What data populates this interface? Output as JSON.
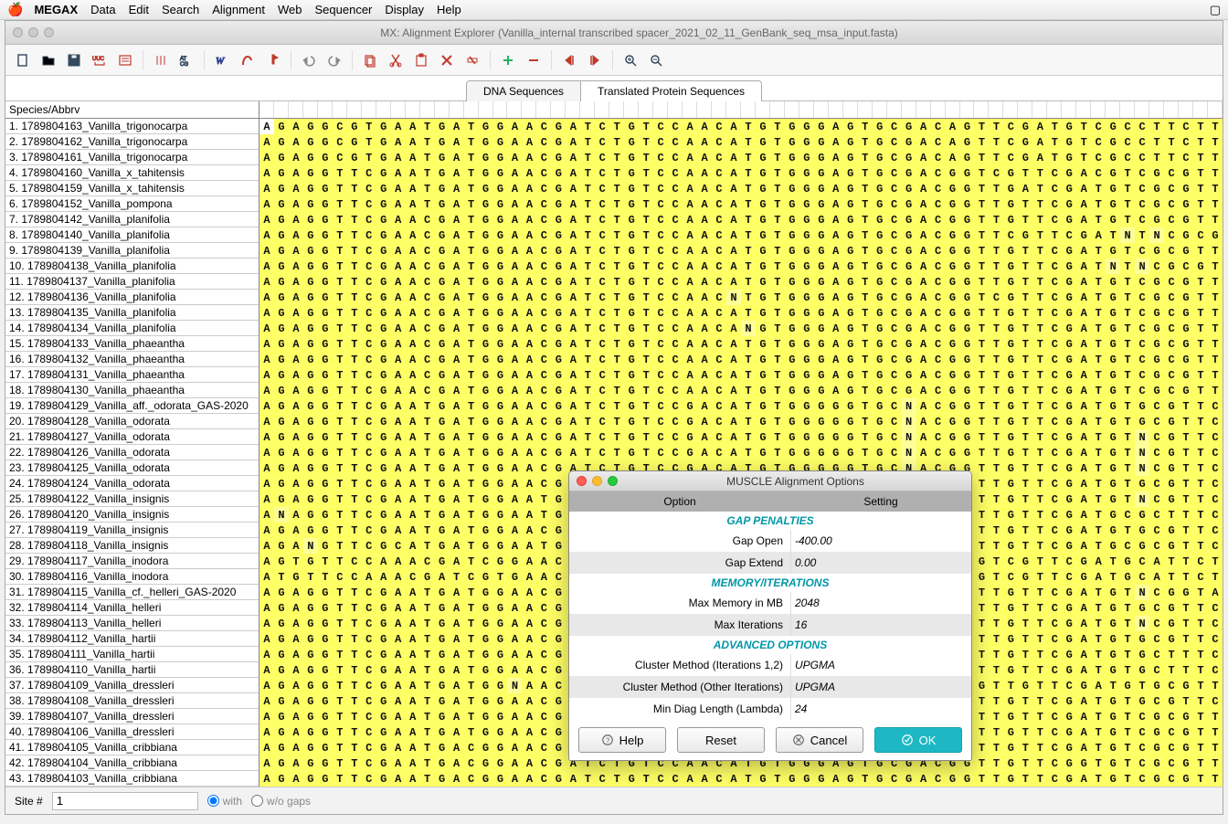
{
  "menubar": {
    "app": "MEGAX",
    "items": [
      "Data",
      "Edit",
      "Search",
      "Alignment",
      "Web",
      "Sequencer",
      "Display",
      "Help"
    ]
  },
  "window": {
    "title": "MX: Alignment Explorer (Vanilla_internal transcribed spacer_2021_02_11_GenBank_seq_msa_input.fasta)"
  },
  "tabs": {
    "dna": "DNA Sequences",
    "protein": "Translated Protein Sequences"
  },
  "species_header": "Species/Abbrv",
  "species": [
    "1. 1789804163_Vanilla_trigonocarpa",
    "2. 1789804162_Vanilla_trigonocarpa",
    "3. 1789804161_Vanilla_trigonocarpa",
    "4. 1789804160_Vanilla_x_tahitensis",
    "5. 1789804159_Vanilla_x_tahitensis",
    "6. 1789804152_Vanilla_pompona",
    "7. 1789804142_Vanilla_planifolia",
    "8. 1789804140_Vanilla_planifolia",
    "9. 1789804139_Vanilla_planifolia",
    "10. 1789804138_Vanilla_planifolia",
    "11. 1789804137_Vanilla_planifolia",
    "12. 1789804136_Vanilla_planifolia",
    "13. 1789804135_Vanilla_planifolia",
    "14. 1789804134_Vanilla_planifolia",
    "15. 1789804133_Vanilla_phaeantha",
    "16. 1789804132_Vanilla_phaeantha",
    "17. 1789804131_Vanilla_phaeantha",
    "18. 1789804130_Vanilla_phaeantha",
    "19. 1789804129_Vanilla_aff._odorata_GAS-2020",
    "20. 1789804128_Vanilla_odorata",
    "21. 1789804127_Vanilla_odorata",
    "22. 1789804126_Vanilla_odorata",
    "23. 1789804125_Vanilla_odorata",
    "24. 1789804124_Vanilla_odorata",
    "25. 1789804122_Vanilla_insignis",
    "26. 1789804120_Vanilla_insignis",
    "27. 1789804119_Vanilla_insignis",
    "28. 1789804118_Vanilla_insignis",
    "29. 1789804117_Vanilla_inodora",
    "30. 1789804116_Vanilla_inodora",
    "31. 1789804115_Vanilla_cf._helleri_GAS-2020",
    "32. 1789804114_Vanilla_helleri",
    "33. 1789804113_Vanilla_helleri",
    "34. 1789804112_Vanilla_hartii",
    "35. 1789804111_Vanilla_hartii",
    "36. 1789804110_Vanilla_hartii",
    "37. 1789804109_Vanilla_dressleri",
    "38. 1789804108_Vanilla_dressleri",
    "39. 1789804107_Vanilla_dressleri",
    "40. 1789804106_Vanilla_dressleri",
    "41. 1789804105_Vanilla_cribbiana",
    "42. 1789804104_Vanilla_cribbiana",
    "43. 1789804103_Vanilla_cribbiana"
  ],
  "sequences": [
    "AGAGGCGTGAATGATGGAACGATCTGTCCAACATGTGGGAGTGCGACAGTTCGATGTCGCCTTCTTCCGTAGCGCGTGCT",
    "AGAGGCGTGAATGATGGAACGATCTGTCCAACATGTGGGAGTGCGACAGTTCGATGTCGCCTTCTTCCGTAGCGCGTGCT",
    "AGAGGCGTGAATGATGGAACGATCTGTCCAACATGTGGGAGTGCGACAGTTCGATGTCGCCTTCTTCCGTAGCGCGTGCT",
    "AGAGGTTCGAATGATGGAACGATCTGTCCAACATGTGGGAGTGCGACGGTCGTTCGACGTCGCGTTCTTTCGTAGCGCGT",
    "AGAGGTTCGAATGATGGAACGATCTGTCCAACATGTGGGAGTGCGACGGTTGATCGATGTCGCGTTCTTTCGTAGCGCGT",
    "AGAGGTTCGAATGATGGAACGATCTGTCCAACATGTGGGAGTGCGACGGTTGTTCGATGTCGCGTTCTTTCGTAGCGCGC",
    "AGAGGTTCGAACGATGGAACGATCTGTCCAACATGTGGGAGTGCGACGGTTGTTCGATGTCGCGTTCTTTCGTAGCGCGT",
    "AGAGGTTCGAACGATGGAACGATCTGTCCAACATGTGGGAGTGCGACGGTTCGTTCGATNTNCGCGTTCTTTCGTAGCGCGT",
    "AGAGGTTCGAACGATGGAACGATCTGTCCAACATGTGGGAGTGCGACGGTTGTTCGATGTCGCGTTCTTTCGTAGCGCGT",
    "AGAGGTTCGAACGATGGAACGATCTGTCCAACATGTGGGAGTGCGACGGTTGTTCGATNTNCGCGTTCTTTCGTAGCGCGT",
    "AGAGGTTCGAACGATGGAACGATCTGTCCAACATGTGGGAGTGCGACGGTTGTTCGATGTCGCGTTCTTTCGTAGCGCGT",
    "AGAGGTTCGAACGATGGAACGATCTGTCCAACNTGTGGGAGTGCGACGGTCGTTCGATGTCGCGTTCTTTCGTAGCGCGT",
    "AGAGGTTCGAACGATGGAACGATCTGTCCAACATGTGGGAGTGCGACGGTTGTTCGATGTCGCGTTCTTTCGTAGCGCGT",
    "AGAGGTTCGAACGATGGAACGATCTGTCCAACANGTGGGAGTGCGACGGTTGTTCGATGTCGCGTTCTTTCGTAGCGCGT",
    "AGAGGTTCGAACGATGGAACGATCTGTCCAACATGTGGGAGTGCGACGGTTGTTCGATGTCGCGTTCTTTCGTAGCGCGC",
    "AGAGGTTCGAACGATGGAACGATCTGTCCAACATGTGGGAGTGCGACGGTTGTTCGATGTCGCGTTCTTTCGTAGCGCGC",
    "AGAGGTTCGAACGATGGAACGATCTGTCCAACATGTGGGAGTGCGACGGTTGTTCGATGTCGCGTTCTTTCGTAGCGCGC",
    "AGAGGTTCGAACGATGGAACGATCTGTCCAACATGTGGGAGTGCGACGGTTGTTCGATGTCGCGTTCTTTCGTAGCGCGC",
    "AGAGGTTCGAATGATGGAACGATCTGTCCGACATGTGGGGGTGCNACGGTTGTTCGATGTGCGTTCTTTCGTAGCGCGTG",
    "AGAGGTTCGAATGATGGAACGATCTGTCCGACATGTGGGGGTGCNACGGTTGTTCGATGTGCGTTCTTTCGTAGCGCGTG",
    "AGAGGTTCGAATGATGGAACGATCTGTCCGACATGTGGGGGTGCNACGGTTGTTCGATGTNCGTTCTCTCGTATCGCGTG",
    "AGAGGTTCGAATGATGGAACGATCTGTCCGACATGTGGGGGTGCNACGGTTGTTCGATGTNCGTTCTCTCGTATCGCGTG",
    "AGAGGTTCGAATGATGGAACGATCTGTCCGACATGTGGGGGTGCNACGGTTGTTCGATGTNCGTTCTCTCGTAGCGCGTG",
    "AGAGGTTCGAATGATGGAACGATCTGTCCGACATGTGGGGGTGCNACGGTTGTTCGATGTGCGTTCTTTCGTAGCGCGTG",
    "AGAGGTTCGAATGATGGAATGATCTGTCCGACATGTGGGGGTGCNACGGTTGTTCGATGTNCGTTCTTTCGTAGCGCGTG",
    "ANAGGTTCGAATGATGGAATGANCTGTCCGACATGTGGGGGTGCAACGGTTGTTCGATGCGCTTTCTTTNGTAGCGCGTG",
    "AGAGGTTCGAATGATGGAACGATCCGTCCGACATGTGGGGGTGCAACGGTTGTTCGATGTGCGTTCTTTCGTAGCGCGTG",
    "AGANGTTCGCATGATGGAATGATCTGTCCGACATGTGGGGGTGCNACGGTTGTTCGATGCGCGTTCTTTCGTAGCGCGTG",
    "AGTGTTCCAAACGATCGGAACGATCTATCCAACATGTGGGAGTGCGACGGTCGTTCGATGCATTCTTCCATCGTGCGCGT",
    "ATGTTCCAAACGATCGTGAACGATCTATCCAACATGTGGGAGTGCGACGGTCGTTCGATGCATTCTTCCATTGTGCGCGT",
    "AGAGGTTCGAATGATGGAACGATCTGTCCGACATGTGGGGGTGCGACGGTTGTTCGATGTNCGGTATTTTCGTAGCGCGT",
    "AGAGGTTCGAATGATGGAACGATCTGTCCGACATGTGGGGGTGCGACGGTTGTTCGATGTGCGTTCTTTCGTAGCGCGTG",
    "AGAGGTTCGAATGATGGAACGATCTGTCCGACATGTGGGGGTGCGACGGTTGTTCGATGTNCGTTCCTTCGTAGCGCGTG",
    "AGAGGTTCGAATGATGGAACGATCTGTCCGACATGTGGAGGTGCGACGGTTGTTCGATGTGCGTTCTTTCGTAGCGCGTG",
    "AGAGGTTCGAATGATGGAACGATCTGTCCGACATGTGGAGGTGCGACGGTTGTTCGATGTGCTTTCTTTCGTAGCGCGTG",
    "AGAGGTTCGAATGATGGAACGATCTGTCCGACATGTGGGGGTGCGACGGTTGTTCGATGTGCTTTCTTTCGTAGCGCGTG",
    "AGAGGTTCGAATGATGGNAACGATCTGTCCGACATGTGGGGGTGCGACGGTTGTTCGATGTGCGTTCTTCGTAGCGCGTG",
    "AGAGGTTCGAATGATGGAACGATCTGTCCGACATGTGGGGGTGCGACGGTTGTTCGATGTGCGTTCTTCGTAGCGCGTGC",
    "AGAGGTTCGAATGATGGAACGATCTGTCCAACATGTGGGAGTGCGACGGTTGTTCGATGTCGCGTTCTTTCGTAGCGCGT",
    "AGAGGTTCGAATGATGGAACGATCTGTCCAACATGTGGGAGTGCGACGGTTGTTCGATGTCGCGTTCTTTCGTAGCGCGT",
    "AGAGGTTCGAATGACGGAACGATCTGTCCAACATGTGGGAGTGCGACGGTTGTTCGATGTCGCGTTCTTTCGTAGCGCGT",
    "AGAGGTTCGAATGACGGAACGATCTGTCCAACATGTGGGAGTGCGACGGTTGTTCGGTGTCGCGTTCTTTCGTAGCGCGT",
    "AGAGGTTCGAATGACGGAACGATCTGTCCAACATGTGGGAGTGCGACGGTTGTTCGATGTCGCGTTCTTTCGTAGCGCGT"
  ],
  "status": {
    "site_label": "Site #",
    "site_value": "1",
    "with": "with",
    "without": "w/o gaps"
  },
  "dialog": {
    "title": "MUSCLE Alignment Options",
    "head_option": "Option",
    "head_setting": "Setting",
    "sec_gap": "GAP PENALTIES",
    "gap_open_k": "Gap Open",
    "gap_open_v": "-400.00",
    "gap_ext_k": "Gap Extend",
    "gap_ext_v": "0.00",
    "sec_mem": "MEMORY/ITERATIONS",
    "maxmem_k": "Max Memory in MB",
    "maxmem_v": "2048",
    "maxit_k": "Max Iterations",
    "maxit_v": "16",
    "sec_adv": "ADVANCED OPTIONS",
    "clust1_k": "Cluster Method (Iterations 1,2)",
    "clust1_v": "UPGMA",
    "clust2_k": "Cluster Method (Other Iterations)",
    "clust2_v": "UPGMA",
    "lambda_k": "Min Diag Length (Lambda)",
    "lambda_v": "24",
    "help": "Help",
    "reset": "Reset",
    "cancel": "Cancel",
    "ok": "OK"
  }
}
